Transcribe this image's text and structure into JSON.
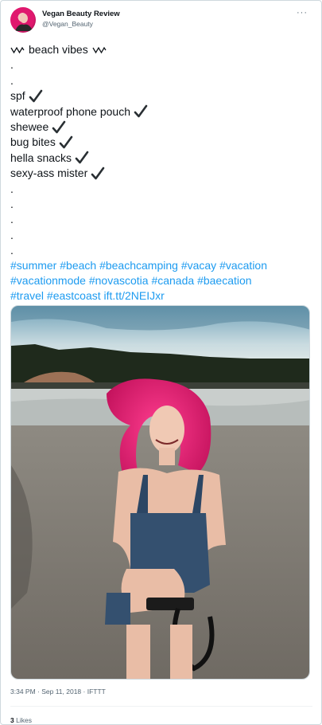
{
  "author": {
    "display_name": "Vegan Beauty Review",
    "handle": "@Vegan_Beauty"
  },
  "more_label": "···",
  "tweet": {
    "heading": "beach vibes",
    "dots_top": [
      ".",
      "."
    ],
    "checklist": [
      "spf",
      "waterproof phone pouch",
      "shewee",
      "bug bites",
      "hella snacks",
      "sexy-ass mister"
    ],
    "dots_bottom": [
      ".",
      ".",
      ".",
      ".",
      "."
    ],
    "hashtag_rows": [
      [
        "#summer",
        "#beach",
        "#beachcamping",
        "#vacay",
        "#vacation"
      ],
      [
        "#vacationmode",
        "#novascotia",
        "#canada",
        "#baecation"
      ],
      [
        "#travel",
        "#eastcoast"
      ]
    ],
    "link": "ift.tt/2NEIJxr"
  },
  "timestamp": "3:34 PM · Sep 11, 2018 · IFTTT",
  "likes": {
    "count": "3",
    "label": "Likes"
  },
  "colors": {
    "link": "#1d9bf0",
    "secondary": "#536471",
    "hair": "#e0186e"
  }
}
